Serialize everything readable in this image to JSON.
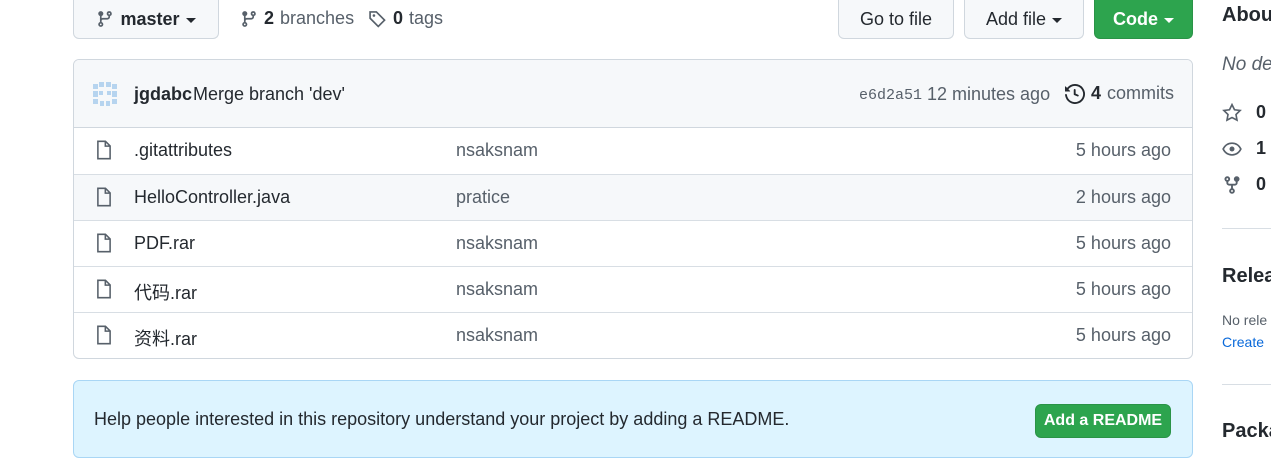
{
  "toolbar": {
    "branch_label": "master",
    "branches_count": "2",
    "branches_label": "branches",
    "tags_count": "0",
    "tags_label": "tags",
    "go_to_file": "Go to file",
    "add_file": "Add file",
    "code": "Code"
  },
  "commit": {
    "author": "jgdabc",
    "message": "Merge branch 'dev'",
    "sha": "e6d2a51",
    "time": "12 minutes ago",
    "commits_count": "4",
    "commits_label": "commits"
  },
  "files": [
    {
      "name": ".gitattributes",
      "message": "nsaksnam",
      "age": "5 hours ago"
    },
    {
      "name": "HelloController.java",
      "message": "pratice",
      "age": "2 hours ago"
    },
    {
      "name": "PDF.rar",
      "message": "nsaksnam",
      "age": "5 hours ago"
    },
    {
      "name": "代码.rar",
      "message": "nsaksnam",
      "age": "5 hours ago"
    },
    {
      "name": "资料.rar",
      "message": "nsaksnam",
      "age": "5 hours ago"
    }
  ],
  "readme_banner": {
    "text": "Help people interested in this repository understand your project by adding a README.",
    "button": "Add a README"
  },
  "sidebar": {
    "about_title": "Abou",
    "description": "No de",
    "stars": "0",
    "watchers": "1",
    "forks": "0",
    "releases_title": "Relea",
    "releases_text": "No rele",
    "releases_link": "Create",
    "packages_title": "Packa"
  },
  "colors": {
    "accent_green": "#2da44e",
    "link_blue": "#0969da",
    "banner_bg": "#ddf4ff"
  },
  "icons": [
    "git-branch-icon",
    "tag-icon",
    "history-icon",
    "file-icon",
    "star-icon",
    "eye-icon",
    "repo-forked-icon"
  ]
}
